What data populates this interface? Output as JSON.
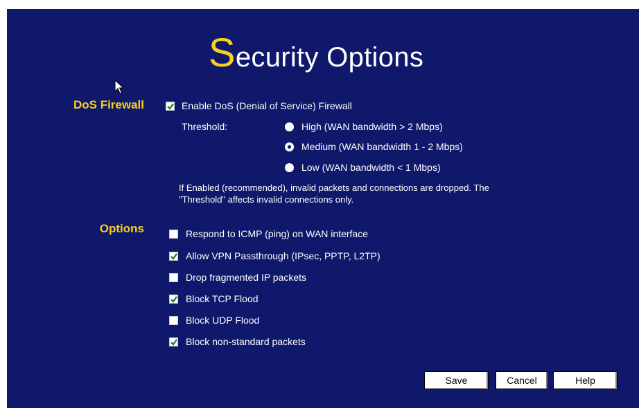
{
  "title": {
    "first_letter": "S",
    "rest": "ecurity Options"
  },
  "dos": {
    "heading": "DoS Firewall",
    "enable": {
      "label": "Enable DoS (Denial of Service) Firewall",
      "checked": true
    },
    "threshold_label": "Threshold:",
    "threshold_options": [
      {
        "label": "High (WAN bandwidth > 2 Mbps)",
        "selected": false
      },
      {
        "label": "Medium (WAN bandwidth 1 - 2 Mbps)",
        "selected": true
      },
      {
        "label": "Low (WAN bandwidth < 1 Mbps)",
        "selected": false
      }
    ],
    "note_line1": "If Enabled (recommended), invalid packets and connections are dropped. The",
    "note_line2": "\"Threshold\" affects invalid connections only."
  },
  "options": {
    "heading": "Options",
    "items": [
      {
        "label": "Respond to ICMP (ping) on WAN interface",
        "checked": false
      },
      {
        "label": "Allow VPN Passthrough (IPsec, PPTP, L2TP)",
        "checked": true
      },
      {
        "label": "Drop fragmented IP packets",
        "checked": false
      },
      {
        "label": "Block TCP Flood",
        "checked": true
      },
      {
        "label": "Block UDP Flood",
        "checked": false
      },
      {
        "label": "Block non-standard packets",
        "checked": true
      }
    ]
  },
  "buttons": {
    "save": "Save",
    "cancel": "Cancel",
    "help": "Help"
  },
  "colors": {
    "panel": "#10186b",
    "heading": "#f8d020",
    "text": "#ffffff",
    "check": "#1a7a1a"
  }
}
